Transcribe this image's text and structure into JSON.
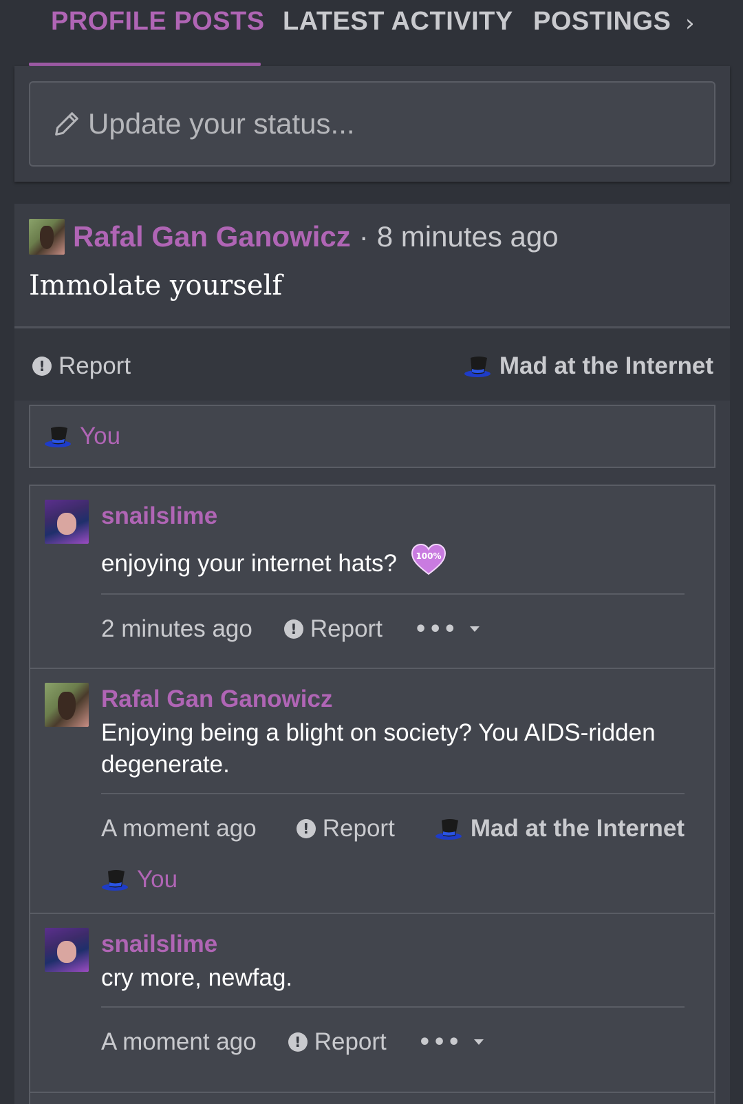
{
  "tabs": {
    "items": [
      {
        "label": "PROFILE POSTS",
        "active": true
      },
      {
        "label": "LATEST ACTIVITY",
        "active": false
      },
      {
        "label": "POSTINGS",
        "active": false
      }
    ],
    "next_icon": "chevron-right-icon"
  },
  "status": {
    "placeholder": "Update your status...",
    "icon": "pencil-icon"
  },
  "post": {
    "author": "Rafal Gan Ganowicz",
    "separator": "·",
    "time": "8 minutes ago",
    "body": "Immolate yourself",
    "report_label": "Report",
    "reaction_label": "Mad at the Internet",
    "reactions": {
      "who": "You",
      "icon": "top-hat-icon"
    }
  },
  "comments": [
    {
      "author": "snailslime",
      "text": "enjoying your internet hats?",
      "emoji_text": "100%",
      "time": "2 minutes ago",
      "report_label": "Report",
      "more_label": "•••"
    },
    {
      "author": "Rafal Gan Ganowicz",
      "text": "Enjoying being a blight on society? You AIDS-ridden degenerate.",
      "time": "A moment ago",
      "report_label": "Report",
      "reaction_label": "Mad at the Internet",
      "reactions_who": "You"
    },
    {
      "author": "snailslime",
      "text": "cry more, newfag.",
      "time": "A moment ago",
      "report_label": "Report",
      "more_label": "•••"
    }
  ],
  "colors": {
    "accent": "#b065b5",
    "background": "#2f3239",
    "panel": "#3a3d45"
  }
}
